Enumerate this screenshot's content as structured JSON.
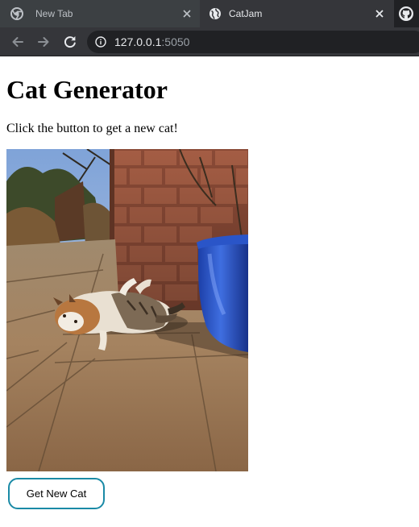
{
  "browser": {
    "tabs": [
      {
        "title": "New Tab",
        "favicon": "chrome-icon",
        "active": false
      },
      {
        "title": "CatJam",
        "favicon": "globe-icon",
        "active": true
      }
    ],
    "address_bar": {
      "host": "127.0.0.1",
      "port": ":5050",
      "security_icon": "info-icon"
    },
    "extension_icon": "github-icon",
    "colors": {
      "tabstrip": "#202124",
      "active_tab": "#35363a",
      "omnibox": "#202124"
    }
  },
  "page": {
    "title": "Cat Generator",
    "subtitle": "Click the button to get a new cat!",
    "image": {
      "subject": "cat lying on its back on a sunny stone patio beside a brick wall and a blue flower pot"
    },
    "button_label": "Get New Cat",
    "button_border_color": "#1a8aa6"
  }
}
